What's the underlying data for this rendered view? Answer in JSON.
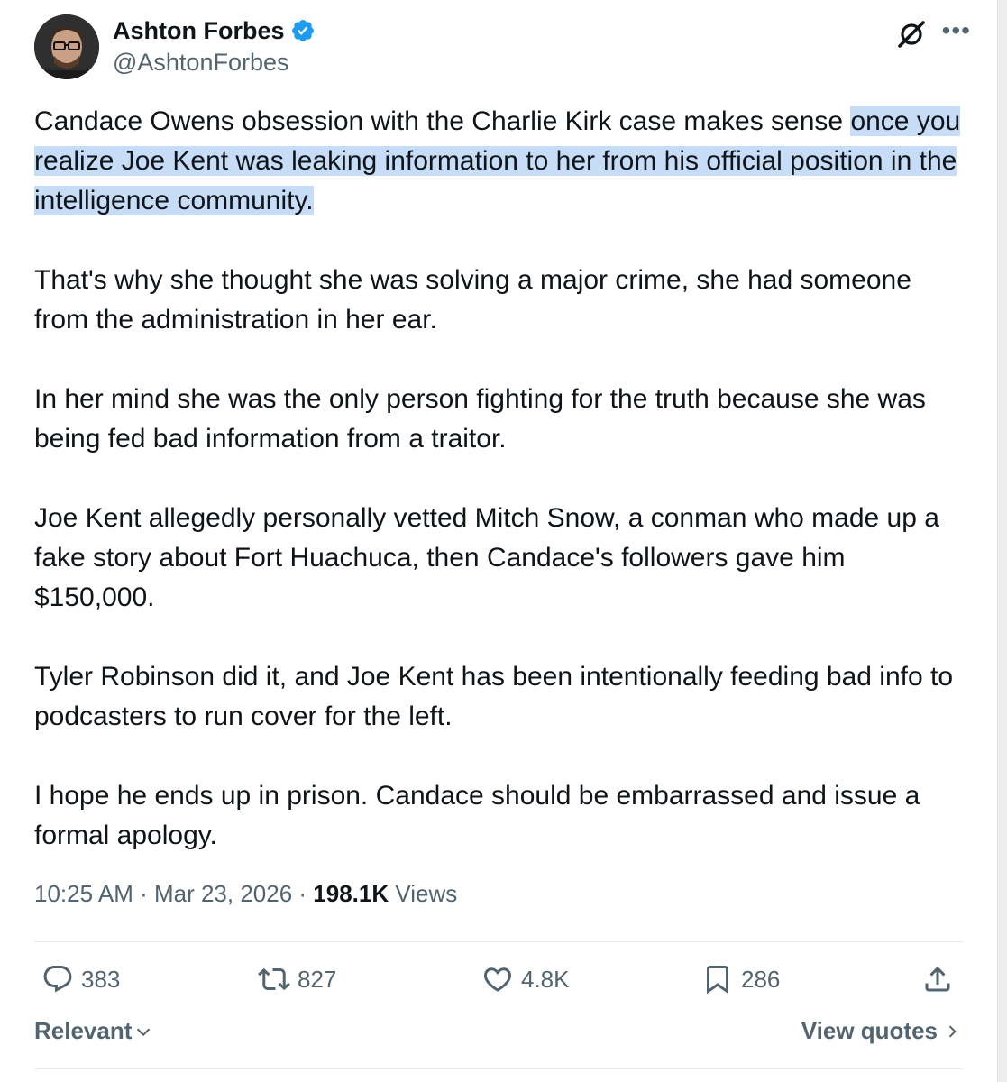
{
  "author": {
    "display_name": "Ashton Forbes",
    "handle": "@AshtonForbes"
  },
  "tweet": {
    "p1_plain": "Candace Owens obsession with the Charlie Kirk case makes sense ",
    "p1_highlight": "once you realize Joe Kent was leaking information to her from his official position in the intelligence community.",
    "p2": "That's why she thought she was solving a major crime, she had someone from the administration in her ear.",
    "p3": "In her mind she was the only person fighting for the truth because she was being fed bad information from a traitor.",
    "p4": "Joe Kent allegedly personally vetted Mitch Snow, a conman who made up a fake story about Fort Huachuca, then Candace's followers gave him $150,000.",
    "p5": "Tyler Robinson did it, and Joe Kent has been intentionally feeding bad info to podcasters to run cover for the left.",
    "p6": "I hope he ends up in prison. Candace should be embarrassed and issue a formal apology."
  },
  "meta": {
    "time": "10:25 AM",
    "sep1": " · ",
    "date": "Mar 23, 2026",
    "sep2": " · ",
    "views_count": "198.1K",
    "views_label": " Views"
  },
  "actions": {
    "replies": "383",
    "reposts": "827",
    "likes": "4.8K",
    "bookmarks": "286"
  },
  "footer": {
    "sort_label": "Relevant",
    "view_quotes_label": "View quotes"
  },
  "colors": {
    "text": "#0f1419",
    "secondary": "#536471",
    "verified_blue": "#1d9bf0",
    "highlight": "#c7dcf7"
  },
  "icons": [
    "verified-badge-icon",
    "grok-icon",
    "more-icon",
    "reply-icon",
    "repost-icon",
    "like-icon",
    "bookmark-icon",
    "share-icon",
    "chevron-down-icon",
    "chevron-right-icon"
  ]
}
